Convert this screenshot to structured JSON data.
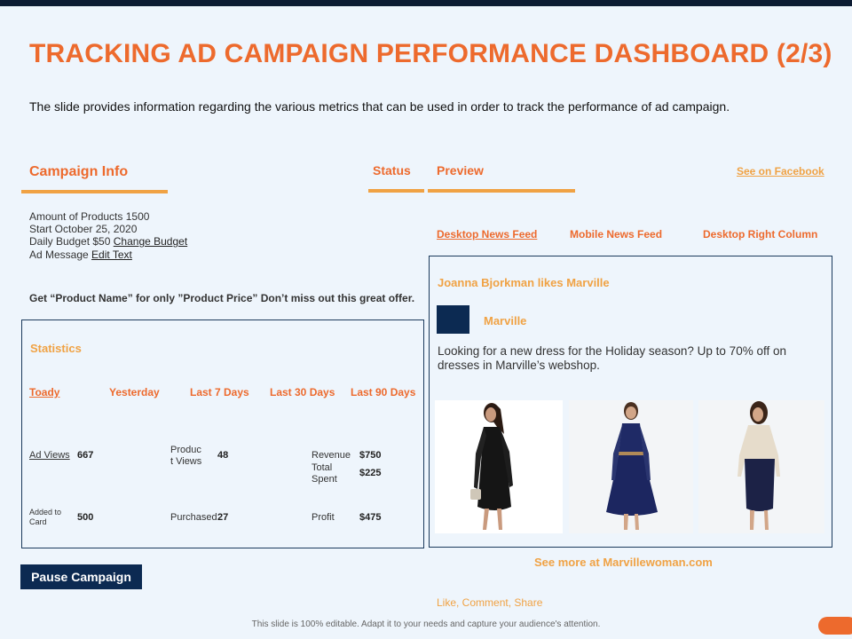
{
  "header": {
    "title": "TRACKING AD CAMPAIGN PERFORMANCE DASHBOARD (2/3)",
    "subtitle": "The slide provides information regarding the various metrics that can be used in order to track the performance of ad campaign."
  },
  "campaign": {
    "section_label": "Campaign Info",
    "status_label": "Status",
    "preview_label": "Preview",
    "see_on_facebook": "See on Facebook",
    "amount_text": "Amount of Products 1500",
    "start_text": "Start October 25, 2020",
    "budget_text": "Daily Budget $50",
    "change_budget": "Change Budget",
    "ad_message_text": "Ad Message",
    "edit_text": "Edit Text",
    "promo": "Get “Product Name” for only ”Product Price” Don’t miss out this great offer."
  },
  "statistics": {
    "title": "Statistics",
    "tabs": [
      "Toady",
      "Yesterday",
      "Last 7 Days",
      "Last 30 Days",
      "Last 90 Days"
    ],
    "ad_views_label": "Ad Views",
    "ad_views_value": "667",
    "product_views_label_1": "Produc",
    "product_views_label_2": "t Views",
    "product_views_value": "48",
    "revenue_label": "Revenue",
    "revenue_value": "$750",
    "total_spent_label_1": "Total",
    "total_spent_label_2": "Spent",
    "total_spent_value": "$225",
    "added_to_card_label_1": "Added to",
    "added_to_card_label_2": "Card",
    "added_to_card_value": "500",
    "purchased_label": "Purchased",
    "purchased_value": "27",
    "profit_label": "Profit",
    "profit_value": "$475"
  },
  "pause_button": "Pause Campaign",
  "preview": {
    "tabs": [
      "Desktop News Feed",
      "Mobile News Feed",
      "Desktop Right Column"
    ],
    "likes_text": "Joanna Bjorkman likes Marville",
    "brand_name": "Marville",
    "post_text_1": "Looking for a new dress for the Holiday season? Up to 70% off on",
    "post_text_2": "dresses in Marville’s webshop.",
    "see_more": "See more at Marvillewoman.com",
    "actions": "Like, Comment, Share"
  },
  "footer": "This slide is 100% editable. Adapt it to your needs and capture your audience's attention.",
  "colors": {
    "accent": "#ed6a2d",
    "accent_light": "#f0a244",
    "navy": "#0c2a52",
    "background": "#eef5fc"
  }
}
